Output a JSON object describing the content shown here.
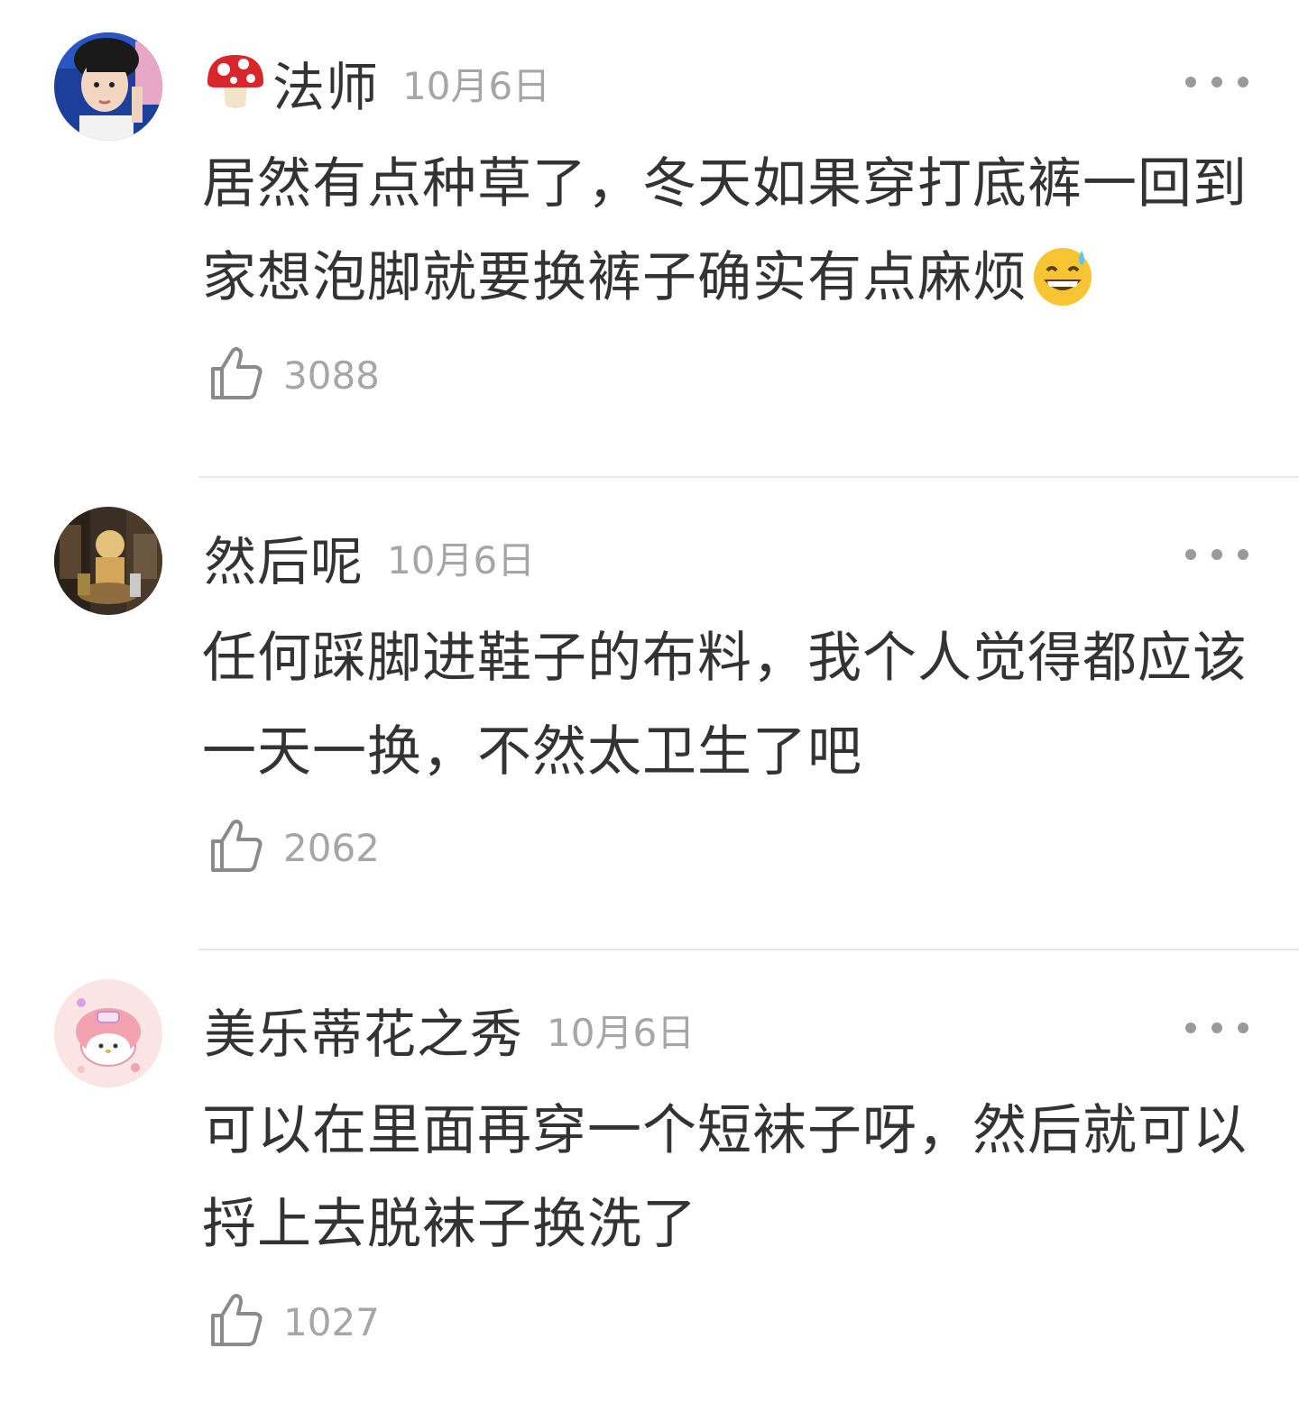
{
  "comments": [
    {
      "username": "法师",
      "badge_icon": "mushroom-icon",
      "date": "10月6日",
      "text": "居然有点种草了，冬天如果穿打底裤一回到家想泡脚就要换裤子确实有点麻烦",
      "trailing_emoji": "grinning-sweat-emoji",
      "likes": "3088",
      "avatar_icon": "avatar-boy-icon"
    },
    {
      "username": "然后呢",
      "date": "10月6日",
      "text": "任何踩脚进鞋子的布料，我个人觉得都应该一天一换，不然太卫生了吧",
      "likes": "2062",
      "avatar_icon": "avatar-room-icon"
    },
    {
      "username": "美乐蒂花之秀",
      "date": "10月6日",
      "text": "可以在里面再穿一个短袜子呀，然后就可以捋上去脱袜子换洗了",
      "likes": "1027",
      "avatar_icon": "avatar-melody-icon"
    }
  ],
  "colors": {
    "text": "#333333",
    "meta": "#a6a6a6",
    "divider": "#e8e8e8"
  }
}
